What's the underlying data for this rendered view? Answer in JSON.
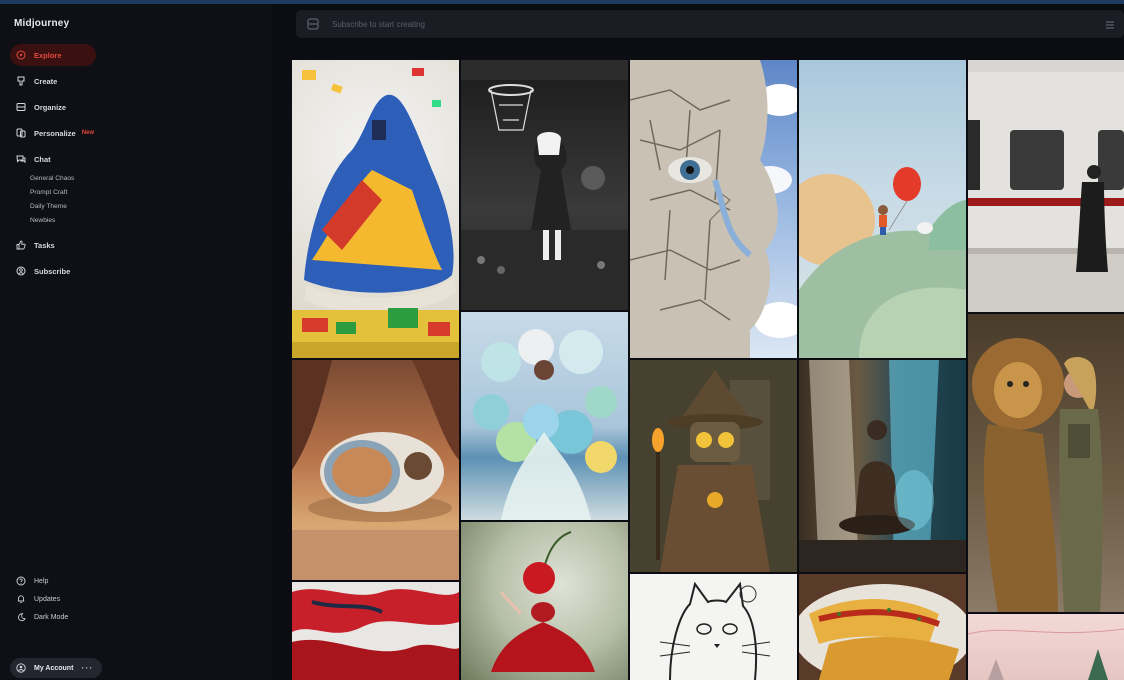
{
  "app": {
    "title": "Midjourney"
  },
  "sidebar": {
    "items": [
      {
        "label": "Explore",
        "icon": "compass-icon",
        "active": true
      },
      {
        "label": "Create",
        "icon": "brush-icon"
      },
      {
        "label": "Organize",
        "icon": "folder-icon"
      },
      {
        "label": "Personalize",
        "icon": "personalize-icon",
        "badge": "New"
      },
      {
        "label": "Chat",
        "icon": "chat-icon"
      }
    ],
    "chat_rooms": [
      "General Chaos",
      "Prompt Craft",
      "Daily Theme",
      "Newbies"
    ],
    "items_after": [
      {
        "label": "Tasks",
        "icon": "thumbs-up-icon"
      },
      {
        "label": "Subscribe",
        "icon": "subscribe-icon"
      }
    ],
    "bottom": [
      {
        "label": "Help",
        "icon": "help-icon"
      },
      {
        "label": "Updates",
        "icon": "bell-icon"
      },
      {
        "label": "Dark Mode",
        "icon": "moon-icon"
      }
    ],
    "account": {
      "label": "My Account",
      "more": "···"
    }
  },
  "search": {
    "placeholder": "Subscribe to start creating"
  },
  "colors": {
    "accent": "#e14a3f",
    "background": "#0b0d12",
    "sidebar": "#0e1016"
  },
  "gallery": {
    "tiles": [
      {
        "name": "lego-sneaker-image"
      },
      {
        "name": "basketball-nun-image"
      },
      {
        "name": "cracked-face-image"
      },
      {
        "name": "balloon-hills-image"
      },
      {
        "name": "subway-train-image"
      },
      {
        "name": "desert-pod-image"
      },
      {
        "name": "balloon-dress-image"
      },
      {
        "name": "wizard-robot-image"
      },
      {
        "name": "meditation-waterfall-image"
      },
      {
        "name": "lion-soldier-image"
      },
      {
        "name": "red-abstract-image"
      },
      {
        "name": "cherry-dancer-image"
      },
      {
        "name": "cat-sketch-image"
      },
      {
        "name": "pasta-dish-image"
      },
      {
        "name": "pink-forest-image"
      }
    ]
  }
}
